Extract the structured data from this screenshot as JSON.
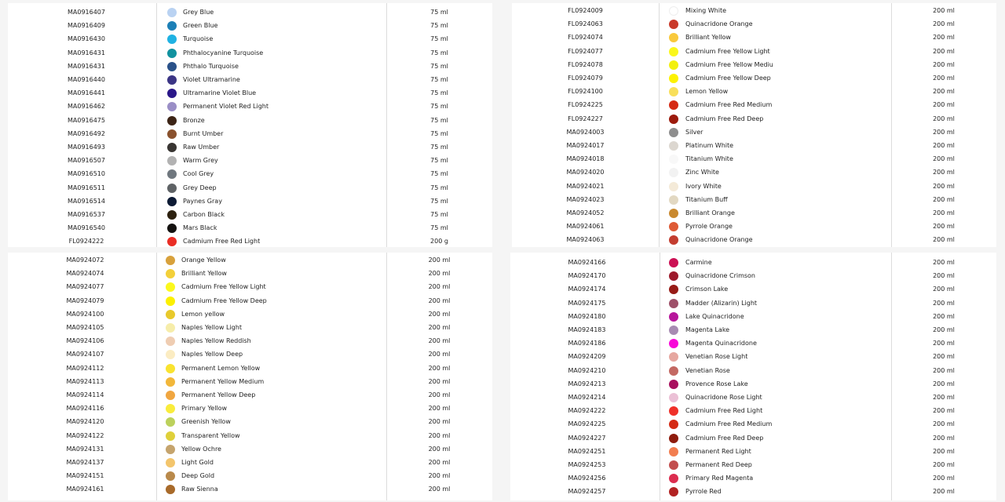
{
  "tables": [
    {
      "rows": [
        {
          "code": "MA0916407",
          "name": "Grey Blue",
          "size": "75 ml",
          "color": "#b9d2f2"
        },
        {
          "code": "MA0916409",
          "name": "Green Blue",
          "size": "75 ml",
          "color": "#1c7fb6"
        },
        {
          "code": "MA0916430",
          "name": "Turquoise",
          "size": "75 ml",
          "color": "#1fb2e3"
        },
        {
          "code": "MA0916431",
          "name": "Phthalocyanine Turquoise",
          "size": "75 ml",
          "color": "#11929f"
        },
        {
          "code": "MA0916431",
          "name": "Phthalo Turquoise",
          "size": "75 ml",
          "color": "#2a5189"
        },
        {
          "code": "MA0916440",
          "name": "Violet Ultramarine",
          "size": "75 ml",
          "color": "#3b3585"
        },
        {
          "code": "MA0916441",
          "name": "Ultramarine Violet Blue",
          "size": "75 ml",
          "color": "#2a1789"
        },
        {
          "code": "MA0916462",
          "name": "Permanent Violet Red Light",
          "size": "75 ml",
          "color": "#9a8ec6"
        },
        {
          "code": "MA0916475",
          "name": "Bronze",
          "size": "75 ml",
          "color": "#3c2416"
        },
        {
          "code": "MA0916492",
          "name": "Burnt Umber",
          "size": "75 ml",
          "color": "#89512d"
        },
        {
          "code": "MA0916493",
          "name": "Raw Umber",
          "size": "75 ml",
          "color": "#383532"
        },
        {
          "code": "MA0916507",
          "name": "Warm Grey",
          "size": "75 ml",
          "color": "#b2b2b2"
        },
        {
          "code": "MA0916510",
          "name": "Cool Grey",
          "size": "75 ml",
          "color": "#6f777e"
        },
        {
          "code": "MA0916511",
          "name": "Grey Deep",
          "size": "75 ml",
          "color": "#5e6265"
        },
        {
          "code": "MA0916514",
          "name": "Paynes Gray",
          "size": "75 ml",
          "color": "#0c1a34"
        },
        {
          "code": "MA0916537",
          "name": "Carbon Black",
          "size": "75 ml",
          "color": "#2c200f"
        },
        {
          "code": "MA0916540",
          "name": "Mars Black",
          "size": "75 ml",
          "color": "#13110f"
        },
        {
          "code": "FL0924222",
          "name": "Cadmium Free Red Light",
          "size": "200 g",
          "color": "#ea2d24"
        }
      ]
    },
    {
      "rows": [
        {
          "code": "FL0924009",
          "name": "Mixing White",
          "size": "200 ml",
          "color": "#ffffff"
        },
        {
          "code": "FL0924063",
          "name": "Quinacridone Orange",
          "size": "200 ml",
          "color": "#c93a2a"
        },
        {
          "code": "FL0924074",
          "name": "Brilliant Yellow",
          "size": "200 ml",
          "color": "#f9c93c"
        },
        {
          "code": "FL0924077",
          "name": "Cadmium Free Yellow Light",
          "size": "200 ml",
          "color": "#faf71c"
        },
        {
          "code": "FL0924078",
          "name": "Cadmium Free Yellow Mediu",
          "size": "200 ml",
          "color": "#f2f00f"
        },
        {
          "code": "FL0924079",
          "name": "Cadmium Free Yellow Deep",
          "size": "200 ml",
          "color": "#fdf200"
        },
        {
          "code": "FL0924100",
          "name": "Lemon Yellow",
          "size": "200 ml",
          "color": "#f8df5a"
        },
        {
          "code": "FL0924225",
          "name": "Cadmium Free Red Medium",
          "size": "200 ml",
          "color": "#d52a14"
        },
        {
          "code": "FL0924227",
          "name": "Cadmium Free Red Deep",
          "size": "200 ml",
          "color": "#9c1a0c"
        },
        {
          "code": "MA0924003",
          "name": "Silver",
          "size": "200 ml",
          "color": "#8e8e8e"
        },
        {
          "code": "MA0924017",
          "name": "Platinum White",
          "size": "200 ml",
          "color": "#dcd7d0"
        },
        {
          "code": "MA0924018",
          "name": "Titanium White",
          "size": "200 ml",
          "color": "#f8f8f8"
        },
        {
          "code": "MA0924020",
          "name": "Zinc White",
          "size": "200 ml",
          "color": "#f2f2f2"
        },
        {
          "code": "MA0924021",
          "name": "Ivory White",
          "size": "200 ml",
          "color": "#f4ead8"
        },
        {
          "code": "MA0924023",
          "name": "Titanium Buff",
          "size": "200 ml",
          "color": "#e2d8c2"
        },
        {
          "code": "MA0924052",
          "name": "Brilliant Orange",
          "size": "200 ml",
          "color": "#c9892f"
        },
        {
          "code": "MA0924061",
          "name": "Pyrrole Orange",
          "size": "200 ml",
          "color": "#de5a35"
        },
        {
          "code": "MA0924063",
          "name": "Quinacridone Orange",
          "size": "200 ml",
          "color": "#c33d2f"
        }
      ]
    },
    {
      "rows": [
        {
          "code": "MA0924072",
          "name": "Orange Yellow",
          "size": "200 ml",
          "color": "#d8a13c"
        },
        {
          "code": "MA0924074",
          "name": "Brilliant Yellow",
          "size": "200 ml",
          "color": "#f3d03a"
        },
        {
          "code": "MA0924077",
          "name": "Cadmium Free Yellow Light",
          "size": "200 ml",
          "color": "#fbf81d"
        },
        {
          "code": "MA0924079",
          "name": "Cadmium Free Yellow Deep",
          "size": "200 ml",
          "color": "#fcf000"
        },
        {
          "code": "MA0924100",
          "name": "Lemon yellow",
          "size": "200 ml",
          "color": "#e8c92b"
        },
        {
          "code": "MA0924105",
          "name": "Naples Yellow Light",
          "size": "200 ml",
          "color": "#f6edaa"
        },
        {
          "code": "MA0924106",
          "name": "Naples Yellow Reddish",
          "size": "200 ml",
          "color": "#efcdb2"
        },
        {
          "code": "MA0924107",
          "name": "Naples Yellow Deep",
          "size": "200 ml",
          "color": "#fbecc2"
        },
        {
          "code": "MA0924112",
          "name": "Permanent Lemon Yellow",
          "size": "200 ml",
          "color": "#f9e330"
        },
        {
          "code": "MA0924113",
          "name": "Permanent Yellow Medium",
          "size": "200 ml",
          "color": "#f2b73a"
        },
        {
          "code": "MA0924114",
          "name": "Permanent Yellow Deep",
          "size": "200 ml",
          "color": "#f0a640"
        },
        {
          "code": "MA0924116",
          "name": "Primary Yellow",
          "size": "200 ml",
          "color": "#f9ec3c"
        },
        {
          "code": "MA0924120",
          "name": "Greenish Yellow",
          "size": "200 ml",
          "color": "#bcd15c"
        },
        {
          "code": "MA0924122",
          "name": "Transparent Yellow",
          "size": "200 ml",
          "color": "#dfd03a"
        },
        {
          "code": "MA0924131",
          "name": "Yellow Ochre",
          "size": "200 ml",
          "color": "#c5a46d"
        },
        {
          "code": "MA0924137",
          "name": "Light Gold",
          "size": "200 ml",
          "color": "#f3c56c"
        },
        {
          "code": "MA0924151",
          "name": "Deep Gold",
          "size": "200 ml",
          "color": "#b9894b"
        },
        {
          "code": "MA0924161",
          "name": "Raw Sienna",
          "size": "200 ml",
          "color": "#a86a2a"
        }
      ]
    },
    {
      "rows": [
        {
          "code": "MA0924166",
          "name": "Carmine",
          "size": "200 ml",
          "color": "#cc1054"
        },
        {
          "code": "MA0924170",
          "name": "Quinacridone Crimson",
          "size": "200 ml",
          "color": "#9d1a2c"
        },
        {
          "code": "MA0924174",
          "name": "Crimson Lake",
          "size": "200 ml",
          "color": "#971b16"
        },
        {
          "code": "MA0924175",
          "name": "Madder (Alizarin) Light",
          "size": "200 ml",
          "color": "#9e5069"
        },
        {
          "code": "MA0924180",
          "name": "Lake Quinacridone",
          "size": "200 ml",
          "color": "#b7169b"
        },
        {
          "code": "MA0924183",
          "name": "Magenta Lake",
          "size": "200 ml",
          "color": "#a78bb2"
        },
        {
          "code": "MA0924186",
          "name": "Magenta Quinacridone",
          "size": "200 ml",
          "color": "#f808d8"
        },
        {
          "code": "MA0924209",
          "name": "Venetian Rose Light",
          "size": "200 ml",
          "color": "#e6a7a0"
        },
        {
          "code": "MA0924210",
          "name": "Venetian Rose",
          "size": "200 ml",
          "color": "#c36862"
        },
        {
          "code": "MA0924213",
          "name": "Provence Rose Lake",
          "size": "200 ml",
          "color": "#a8105e"
        },
        {
          "code": "MA0924214",
          "name": "Quinacridone Rose Light",
          "size": "200 ml",
          "color": "#ebc0d6"
        },
        {
          "code": "MA0924222",
          "name": "Cadmium Free Red Light",
          "size": "200 ml",
          "color": "#ef3029"
        },
        {
          "code": "MA0924225",
          "name": "Cadmium Free Red Medium",
          "size": "200 ml",
          "color": "#d42a14"
        },
        {
          "code": "MA0924227",
          "name": "Cadmium Free Red Deep",
          "size": "200 ml",
          "color": "#8e1b0c"
        },
        {
          "code": "MA0924251",
          "name": "Permanent Red Light",
          "size": "200 ml",
          "color": "#f27d4f"
        },
        {
          "code": "MA0924253",
          "name": "Permanent Red Deep",
          "size": "200 ml",
          "color": "#c24e4e"
        },
        {
          "code": "MA0924256",
          "name": "Primary Red Magenta",
          "size": "200 ml",
          "color": "#dc2d4f"
        },
        {
          "code": "MA0924257",
          "name": "Pyrrole Red",
          "size": "200 ml",
          "color": "#b22222"
        }
      ]
    }
  ]
}
